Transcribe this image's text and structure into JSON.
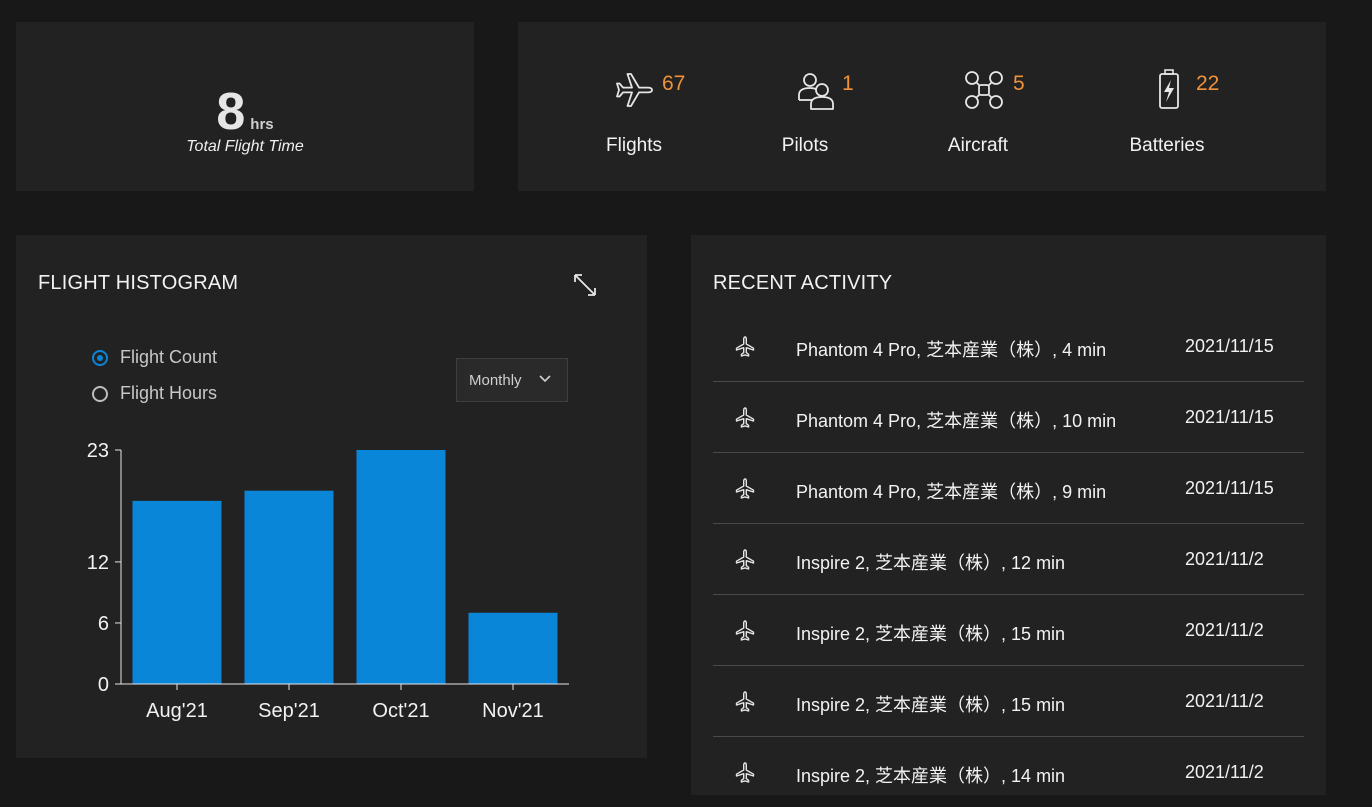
{
  "summary": {
    "total_flight_time_value": "8",
    "total_flight_time_unit": "hrs",
    "total_flight_time_label": "Total Flight Time"
  },
  "stats": [
    {
      "icon": "airplane-icon",
      "value": "67",
      "label": "Flights"
    },
    {
      "icon": "pilots-icon",
      "value": "1",
      "label": "Pilots"
    },
    {
      "icon": "drone-icon",
      "value": "5",
      "label": "Aircraft"
    },
    {
      "icon": "battery-icon",
      "value": "22",
      "label": "Batteries"
    }
  ],
  "colors": {
    "accent_orange": "#f0923a",
    "bar_blue": "#0a86d8",
    "panel_bg": "#222222",
    "page_bg": "#181818"
  },
  "histogram": {
    "title": "FLIGHT HISTOGRAM",
    "expand_icon": "expand-icon",
    "options": [
      {
        "label": "Flight Count",
        "selected": true
      },
      {
        "label": "Flight Hours",
        "selected": false
      }
    ],
    "period": "Monthly"
  },
  "chart_data": {
    "type": "bar",
    "categories": [
      "Aug'21",
      "Sep'21",
      "Oct'21",
      "Nov'21"
    ],
    "values": [
      18,
      19,
      23,
      7
    ],
    "yticks": [
      0,
      6,
      12,
      23
    ],
    "ylim": [
      0,
      23
    ],
    "xlabel": "",
    "ylabel": "",
    "grid": false
  },
  "recent": {
    "title": "RECENT ACTIVITY",
    "rows": [
      {
        "icon": "airplane-icon",
        "description": "Phantom 4 Pro, 芝本産業（株）, 4 min",
        "date": "2021/11/15"
      },
      {
        "icon": "airplane-icon",
        "description": "Phantom 4 Pro, 芝本産業（株）, 10 min",
        "date": "2021/11/15"
      },
      {
        "icon": "airplane-icon",
        "description": "Phantom 4 Pro, 芝本産業（株）, 9 min",
        "date": "2021/11/15"
      },
      {
        "icon": "airplane-icon",
        "description": "Inspire 2, 芝本産業（株）, 12 min",
        "date": "2021/11/2"
      },
      {
        "icon": "airplane-icon",
        "description": "Inspire 2, 芝本産業（株）, 15 min",
        "date": "2021/11/2"
      },
      {
        "icon": "airplane-icon",
        "description": "Inspire 2, 芝本産業（株）, 15 min",
        "date": "2021/11/2"
      },
      {
        "icon": "airplane-icon",
        "description": "Inspire 2, 芝本産業（株）, 14 min",
        "date": "2021/11/2"
      }
    ]
  }
}
